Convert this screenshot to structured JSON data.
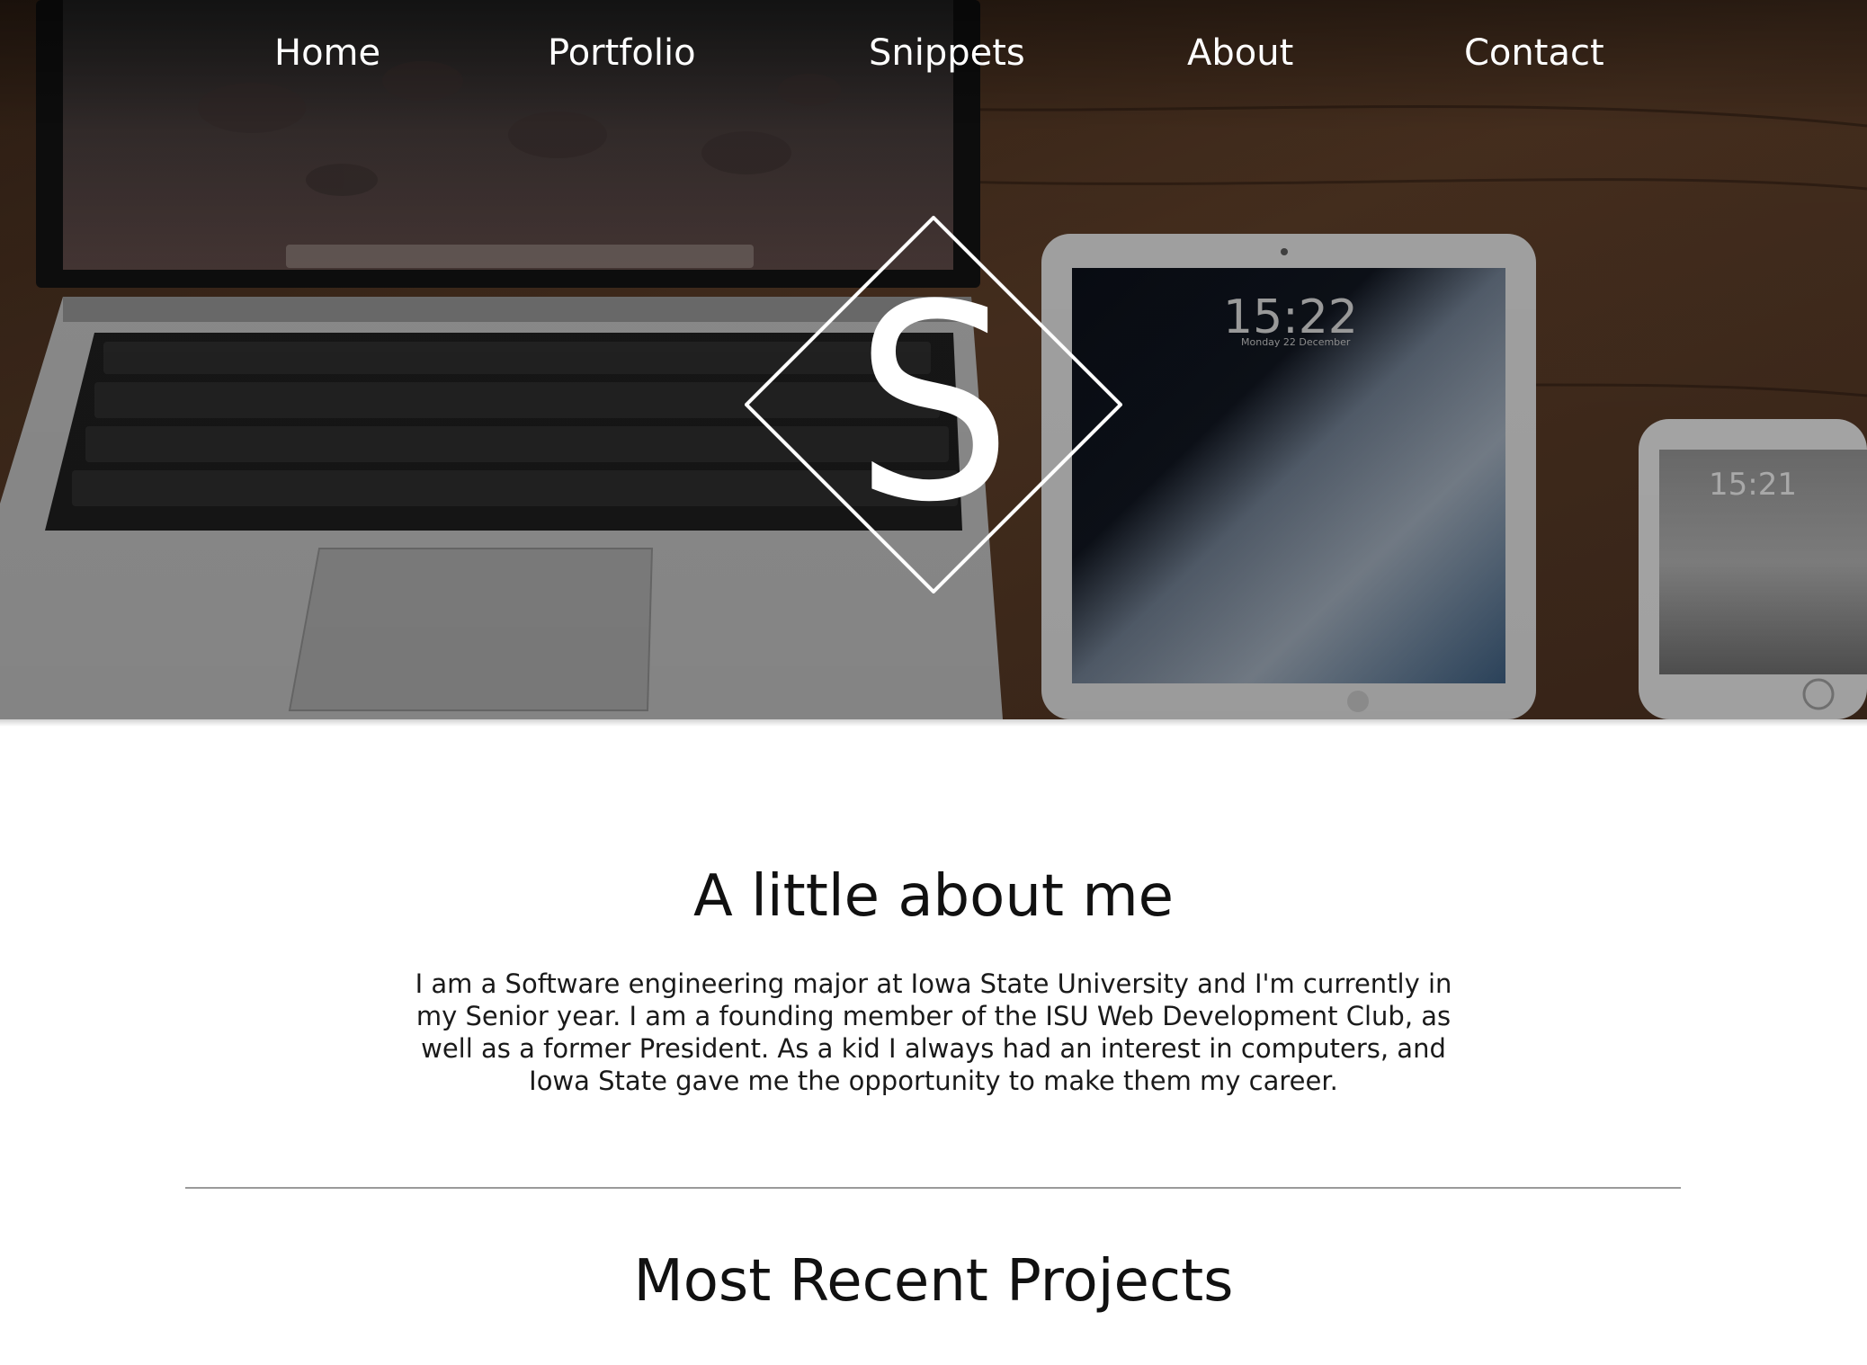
{
  "nav": {
    "items": [
      {
        "label": "Home"
      },
      {
        "label": "Portfolio"
      },
      {
        "label": "Snippets"
      },
      {
        "label": "About"
      },
      {
        "label": "Contact"
      }
    ]
  },
  "hero": {
    "logo_letter": "S",
    "tablet_time": "15:22",
    "tablet_date": "Monday 22 December",
    "phone_time": "15:21"
  },
  "about": {
    "title": "A little about me",
    "text": "I am a Software engineering major at Iowa State University and I'm currently in my Senior year. I am a founding member of the ISU Web Development Club, as well as a former President. As a kid I always had an interest in computers, and Iowa State gave me the opportunity to make them my career."
  },
  "projects": {
    "title": "Most Recent Projects"
  },
  "colors": {
    "text_dark": "#111111",
    "nav_text": "#ffffff",
    "divider": "#9a9a9a"
  }
}
